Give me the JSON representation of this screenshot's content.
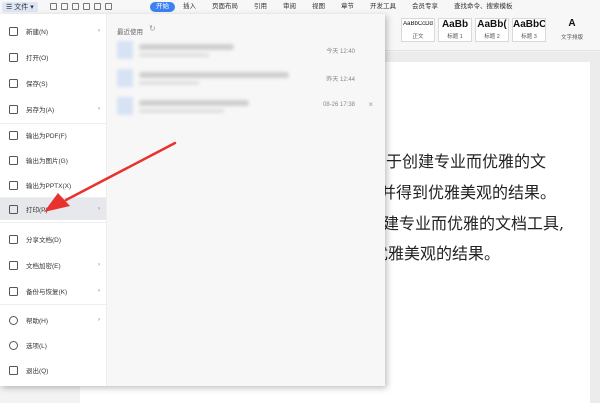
{
  "toolbar": {
    "file_label": "文件"
  },
  "tabs": [
    "开始",
    "插入",
    "页面布局",
    "引用",
    "审阅",
    "视图",
    "章节",
    "开发工具",
    "会员专享",
    "查找命令、搜索模板"
  ],
  "styles": [
    {
      "sample": "AaBbCcDd",
      "name": "正文"
    },
    {
      "sample": "AaBb",
      "name": "标题 1"
    },
    {
      "sample": "AaBb(",
      "name": "标题 2"
    },
    {
      "sample": "AaBbC(",
      "name": "标题 3"
    },
    {
      "sample": "",
      "name": "文字排版"
    }
  ],
  "menu": [
    {
      "label": "新建(N)",
      "icon": "new-icon",
      "arrow": true
    },
    {
      "label": "打开(O)",
      "icon": "open-icon",
      "arrow": false
    },
    {
      "label": "保存(S)",
      "icon": "save-icon",
      "arrow": false
    },
    {
      "label": "另存为(A)",
      "icon": "save-as-icon",
      "arrow": true
    },
    {
      "label": "输出为PDF(F)",
      "icon": "pdf-icon",
      "arrow": false
    },
    {
      "label": "输出为图片(G)",
      "icon": "image-icon",
      "arrow": false
    },
    {
      "label": "输出为PPTX(X)",
      "icon": "pptx-icon",
      "arrow": false
    },
    {
      "label": "打印(P)",
      "icon": "print-icon",
      "arrow": true
    },
    {
      "label": "分享文档(D)",
      "icon": "share-icon",
      "arrow": false
    },
    {
      "label": "文档加密(E)",
      "icon": "lock-icon",
      "arrow": true
    },
    {
      "label": "备份与恢复(K)",
      "icon": "backup-icon",
      "arrow": true
    },
    {
      "label": "帮助(H)",
      "icon": "help-icon",
      "arrow": true
    },
    {
      "label": "选项(L)",
      "icon": "gear-icon",
      "arrow": false
    },
    {
      "label": "退出(Q)",
      "icon": "exit-icon",
      "arrow": false
    }
  ],
  "recent": {
    "title": "最近使用",
    "items": [
      {
        "time": "今天 12:40"
      },
      {
        "time": "昨天 12:44"
      },
      {
        "time": "08-26 17:38"
      }
    ]
  },
  "document": {
    "lines": [
      "用于创建专业而优雅的文",
      "并得到优雅美观的结果。",
      "建专业而优雅的文档工具,",
      "优雅美观的结果。"
    ]
  },
  "colors": {
    "accent": "#3c82f1",
    "arrow": "#e8322d"
  }
}
